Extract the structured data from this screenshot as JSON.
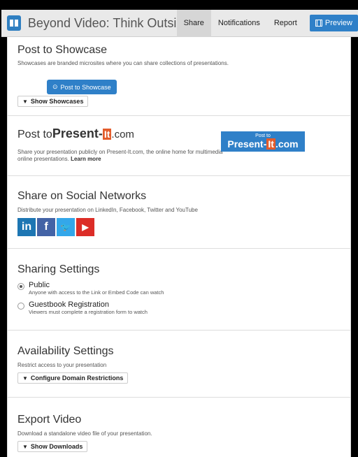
{
  "header": {
    "title": "Beyond Video: Think Outside th...",
    "tabs": [
      "Share",
      "Notifications",
      "Report"
    ],
    "preview_label": "Preview",
    "logo_icon": "presentation-logo-icon"
  },
  "showcase": {
    "heading": "Post to Showcase",
    "desc": "Showcases are branded microsites where you can share collections of presentations.",
    "button": "Post to Showcase",
    "toggle": "Show Showcases"
  },
  "presentit": {
    "heading_prefix": "Post to ",
    "brand": "Present-",
    "brand_mark": "It",
    "brand_suffix": ".com",
    "desc": "Share your presentation publicly on Present-It.com, the online home for multimedia online presentations.",
    "learn_more": "Learn more",
    "badge_top": "Post to"
  },
  "social": {
    "heading": "Share on Social Networks",
    "desc": "Distribute your presentation on LinkedIn, Facebook, Twitter and YouTube",
    "icons": [
      {
        "name": "linkedin-icon",
        "glyph": "in",
        "color": "#1d76b3"
      },
      {
        "name": "facebook-icon",
        "glyph": "f",
        "color": "#4363a6"
      },
      {
        "name": "twitter-icon",
        "glyph": "🐦",
        "color": "#33a7ea"
      },
      {
        "name": "youtube-icon",
        "glyph": "▶",
        "color": "#dc2d27"
      }
    ]
  },
  "sharing": {
    "heading": "Sharing Settings",
    "options": [
      {
        "title": "Public",
        "desc": "Anyone with access to the Link or Embed Code can watch",
        "checked": true
      },
      {
        "title": "Guestbook Registration",
        "desc": "Viewers must complete a registration form to watch",
        "checked": false
      }
    ]
  },
  "availability": {
    "heading": "Availability Settings",
    "desc": "Restrict access to your presentation",
    "toggle": "Configure Domain Restrictions"
  },
  "export": {
    "heading": "Export Video",
    "desc": "Download a standalone video file of your presentation.",
    "toggle": "Show Downloads"
  }
}
